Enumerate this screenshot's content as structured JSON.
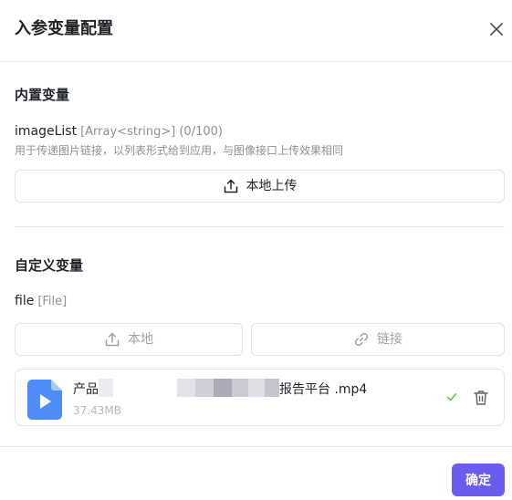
{
  "dialog": {
    "title": "入参变量配置"
  },
  "builtin": {
    "section_title": "内置变量",
    "var_name": "imageList",
    "var_type": "[Array<string>]",
    "var_count": "(0/100)",
    "description": "用于传递图片链接，以列表形式给到应用，与图像接口上传效果相同",
    "upload_label": "本地上传"
  },
  "custom": {
    "section_title": "自定义变量",
    "var_name": "file",
    "var_type": "[File]",
    "local_label": "本地",
    "link_label": "链接"
  },
  "file": {
    "name_prefix": "产品",
    "name_suffix": "报告平台 .mp4",
    "size": "37.43MB",
    "icon": "video-file-icon",
    "status": "uploaded"
  },
  "footer": {
    "confirm_label": "确定"
  },
  "colors": {
    "accent": "#6b5cf0",
    "file_icon": "#4e8cf7",
    "success": "#52c41a"
  }
}
